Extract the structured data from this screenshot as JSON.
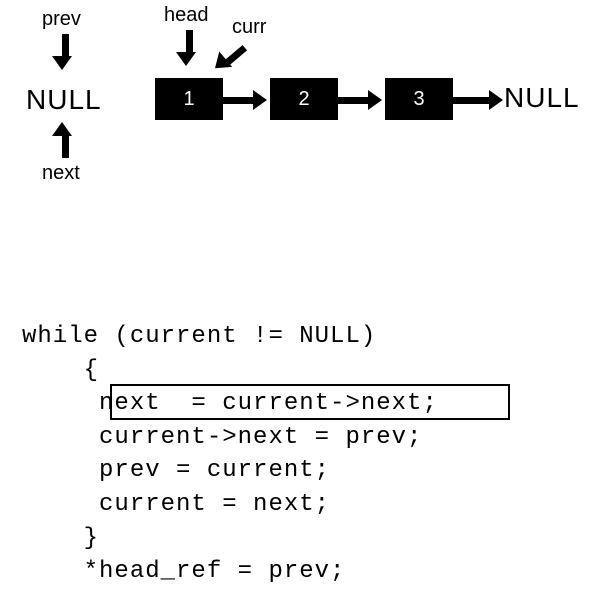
{
  "diagram": {
    "labels": {
      "prev": "prev",
      "head": "head",
      "curr": "curr",
      "next": "next"
    },
    "nullLeft": "NULL",
    "nullRight": "NULL",
    "nodes": [
      "1",
      "2",
      "3"
    ]
  },
  "code": {
    "line1": "while (current != NULL)",
    "line2": "    {",
    "line3": "     next  = current->next;",
    "line4": "     current->next = prev;",
    "line5": "     prev = current;",
    "line6": "     current = next;",
    "line7": "    }",
    "line8": "    *head_ref = prev;"
  }
}
